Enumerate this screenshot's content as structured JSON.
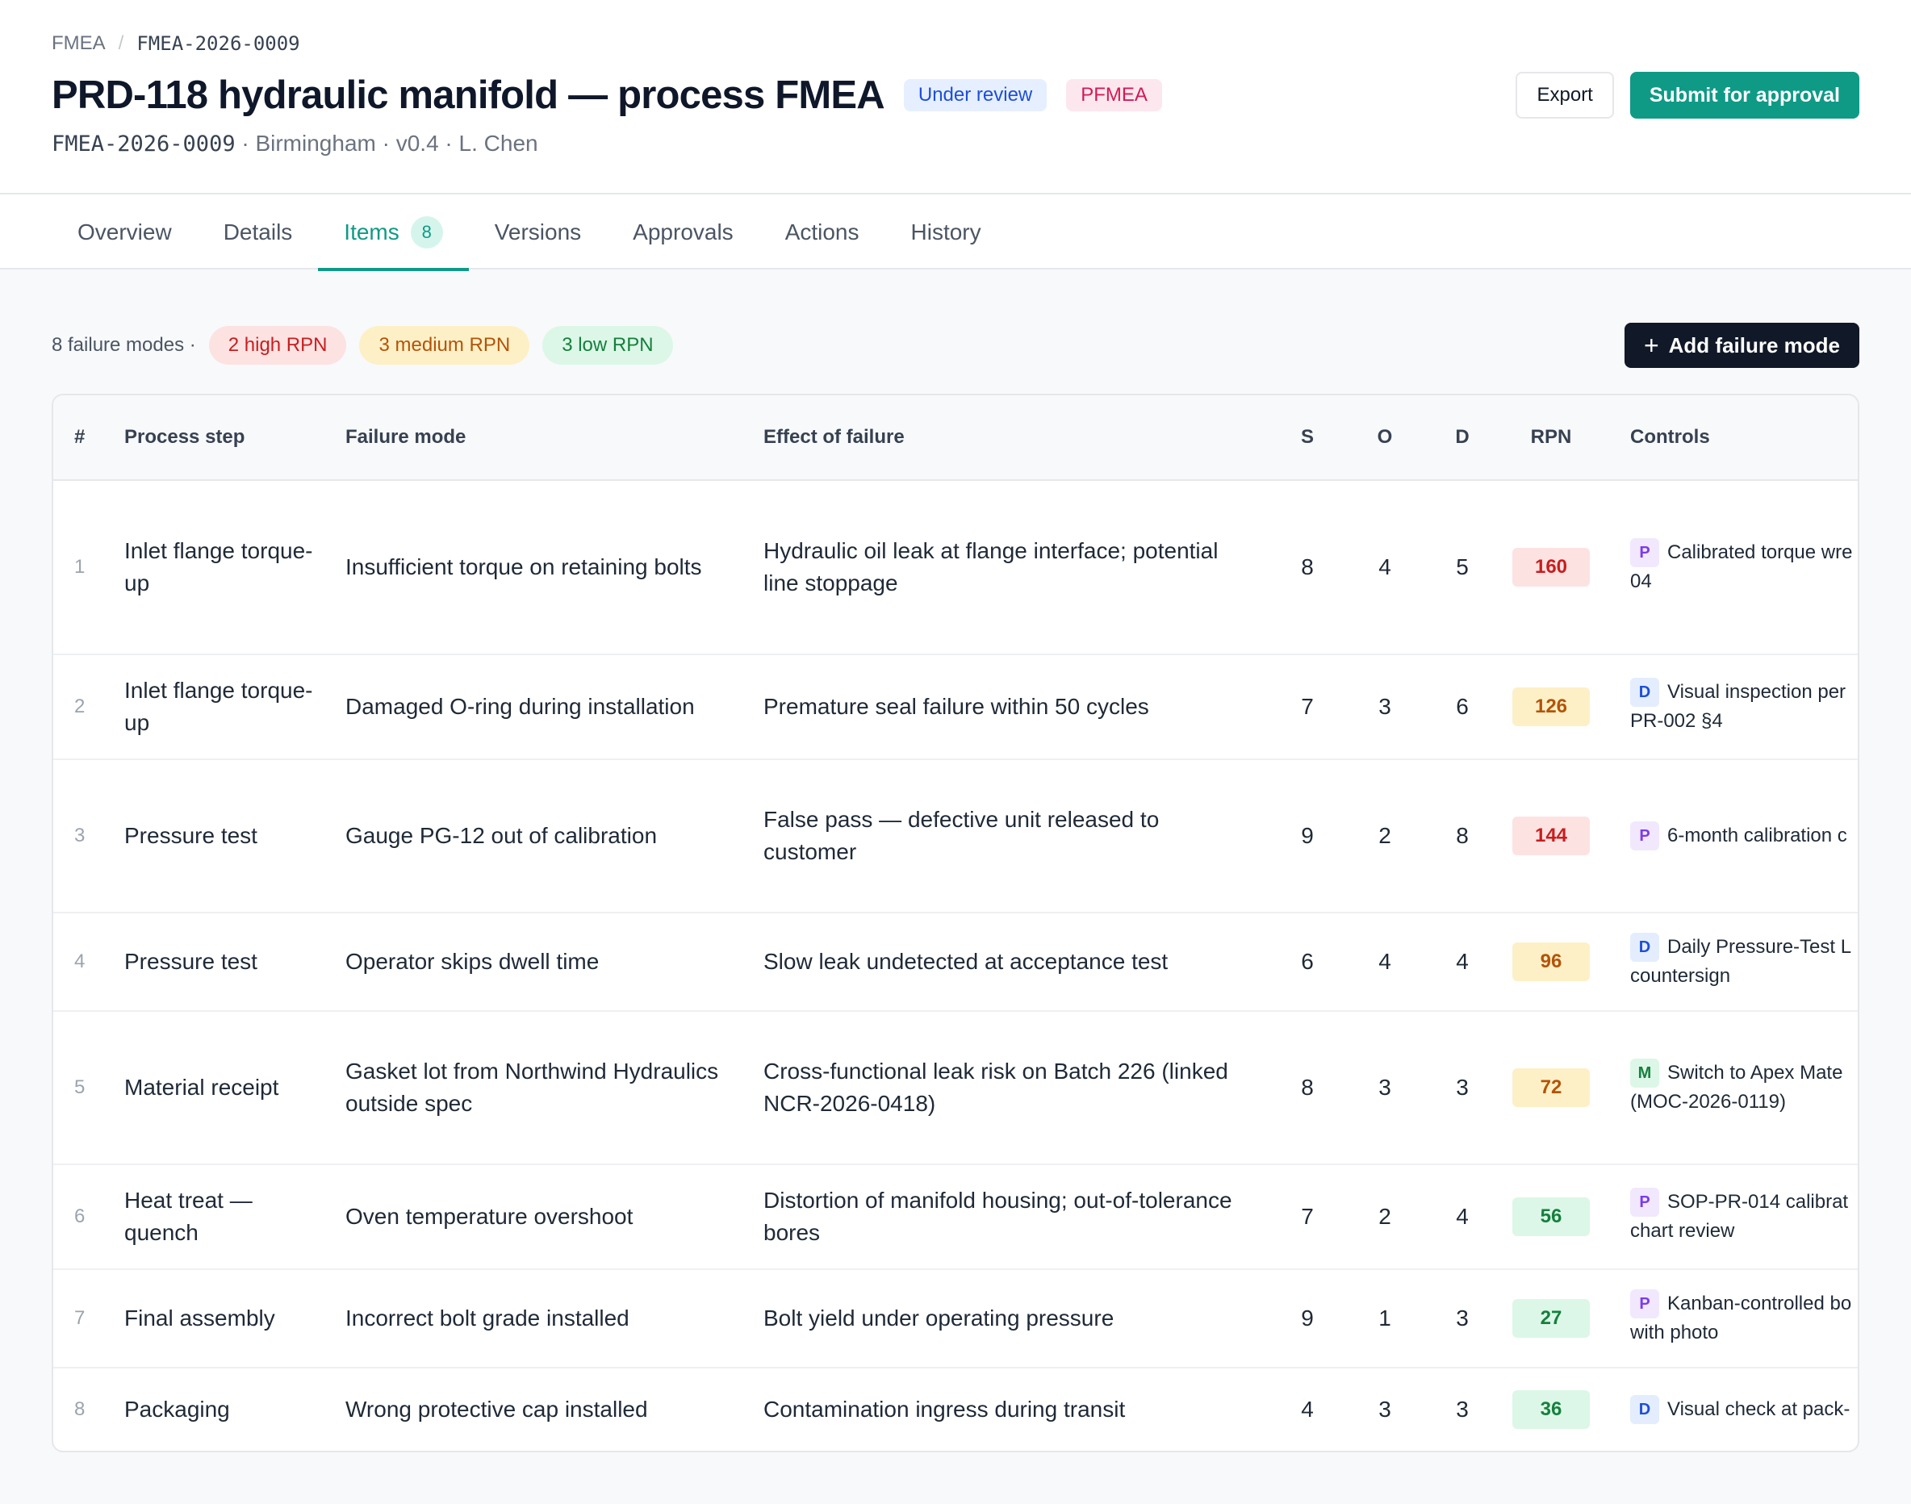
{
  "breadcrumb": {
    "root": "FMEA",
    "sep": "/",
    "current": "FMEA-2026-0009"
  },
  "header": {
    "title": "PRD-118 hydraulic manifold — process FMEA",
    "status_badge": "Under review",
    "type_badge": "PFMEA",
    "doc_id": "FMEA-2026-0009",
    "meta": "· Birmingham · v0.4 · L. Chen",
    "export_label": "Export",
    "submit_label": "Submit for approval"
  },
  "tabs": [
    {
      "label": "Overview"
    },
    {
      "label": "Details"
    },
    {
      "label": "Items",
      "count": "8"
    },
    {
      "label": "Versions"
    },
    {
      "label": "Approvals"
    },
    {
      "label": "Actions"
    },
    {
      "label": "History"
    }
  ],
  "summary": {
    "text": "8 failure modes ·",
    "high": "2 high RPN",
    "medium": "3 medium RPN",
    "low": "3 low RPN",
    "add_label": "Add failure mode"
  },
  "table": {
    "headers": [
      "#",
      "Process step",
      "Failure mode",
      "Effect of failure",
      "S",
      "O",
      "D",
      "RPN",
      "Controls"
    ],
    "rows": [
      {
        "n": "1",
        "step": "Inlet flange torque-up",
        "mode": "Insufficient torque on retaining bolts",
        "effect": "Hydraulic oil leak at flange interface; potential line stoppage",
        "s": "8",
        "o": "4",
        "d": "5",
        "rpn": "160",
        "level": "high",
        "ctype": "P",
        "ctl1": "Calibrated torque wre",
        "ctl2": "04"
      },
      {
        "n": "2",
        "step": "Inlet flange torque-up",
        "mode": "Damaged O-ring during installation",
        "effect": "Premature seal failure within 50 cycles",
        "s": "7",
        "o": "3",
        "d": "6",
        "rpn": "126",
        "level": "med",
        "ctype": "D",
        "ctl1": "Visual inspection per",
        "ctl2": "PR-002 §4"
      },
      {
        "n": "3",
        "step": "Pressure test",
        "mode": "Gauge PG-12 out of calibration",
        "effect": "False pass — defective unit released to customer",
        "s": "9",
        "o": "2",
        "d": "8",
        "rpn": "144",
        "level": "high",
        "ctype": "P",
        "ctl1": "6-month calibration c",
        "ctl2": ""
      },
      {
        "n": "4",
        "step": "Pressure test",
        "mode": "Operator skips dwell time",
        "effect": "Slow leak undetected at acceptance test",
        "s": "6",
        "o": "4",
        "d": "4",
        "rpn": "96",
        "level": "med",
        "ctype": "D",
        "ctl1": "Daily Pressure-Test L",
        "ctl2": "countersign"
      },
      {
        "n": "5",
        "step": "Material receipt",
        "mode": "Gasket lot from Northwind Hydraulics outside spec",
        "effect": "Cross-functional leak risk on Batch 226 (linked NCR-2026-0418)",
        "s": "8",
        "o": "3",
        "d": "3",
        "rpn": "72",
        "level": "med",
        "ctype": "M",
        "ctl1": "Switch to Apex Mate",
        "ctl2": "(MOC-2026-0119)"
      },
      {
        "n": "6",
        "step": "Heat treat — quench",
        "mode": "Oven temperature overshoot",
        "effect": "Distortion of manifold housing; out-of-tolerance bores",
        "s": "7",
        "o": "2",
        "d": "4",
        "rpn": "56",
        "level": "low",
        "ctype": "P",
        "ctl1": "SOP-PR-014 calibrat",
        "ctl2": "chart review"
      },
      {
        "n": "7",
        "step": "Final assembly",
        "mode": "Incorrect bolt grade installed",
        "effect": "Bolt yield under operating pressure",
        "s": "9",
        "o": "1",
        "d": "3",
        "rpn": "27",
        "level": "low",
        "ctype": "P",
        "ctl1": "Kanban-controlled bo",
        "ctl2": "with photo"
      },
      {
        "n": "8",
        "step": "Packaging",
        "mode": "Wrong protective cap installed",
        "effect": "Contamination ingress during transit",
        "s": "4",
        "o": "3",
        "d": "3",
        "rpn": "36",
        "level": "low",
        "ctype": "D",
        "ctl1": "Visual check at pack-",
        "ctl2": ""
      }
    ]
  },
  "colors": {
    "accent": "#0f9a86",
    "high": "#c81e1e",
    "medium": "#b45309",
    "low": "#15803d"
  }
}
